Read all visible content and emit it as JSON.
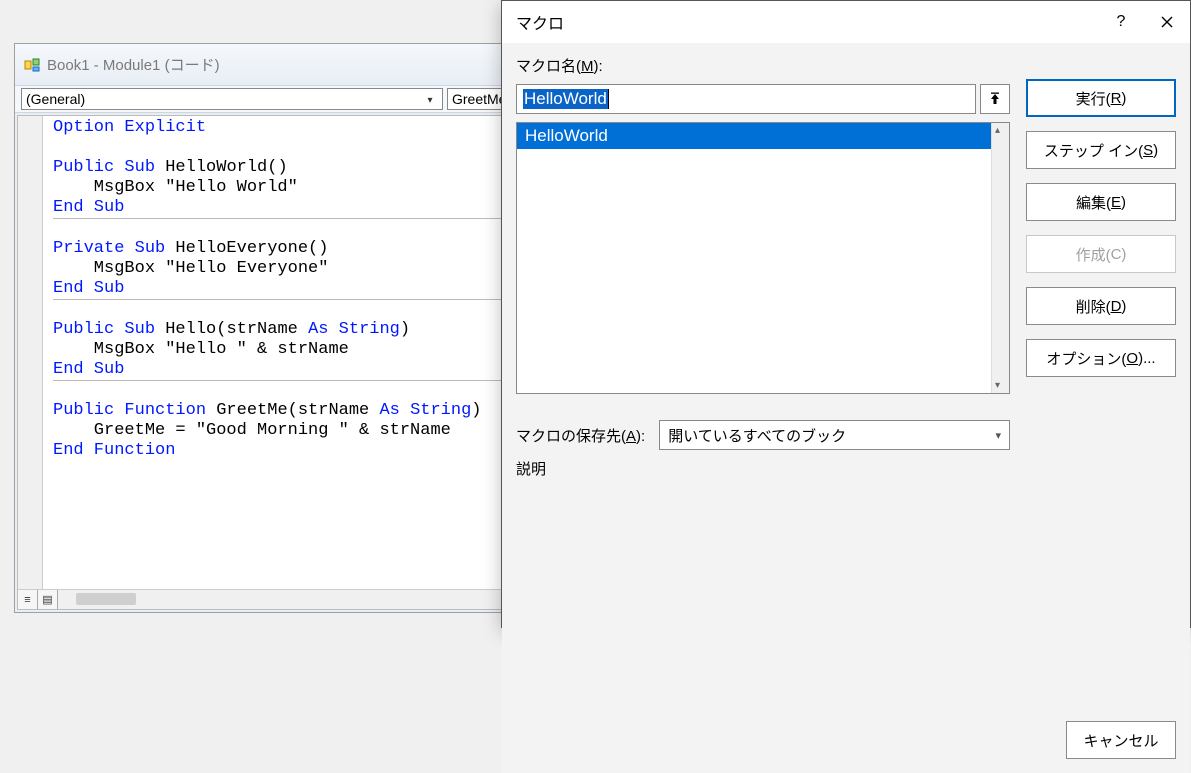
{
  "code_window": {
    "title": "Book1 - Module1 (コード)",
    "left_combo": "(General)",
    "right_combo": "GreetMe",
    "code_html": "<span class=\"kw\">Option Explicit</span>\n\n<span class=\"kw\">Public Sub</span> HelloWorld()\n    MsgBox \"Hello World\"\n<span class=\"kw\">End Sub</span>\n<hr class=\"hr-sep\">\n<span class=\"kw\">Private Sub</span> HelloEveryone()\n    MsgBox \"Hello Everyone\"\n<span class=\"kw\">End Sub</span>\n<hr class=\"hr-sep\">\n<span class=\"kw\">Public Sub</span> Hello(strName <span class=\"kw\">As String</span>)\n    MsgBox \"Hello \" & strName\n<span class=\"kw\">End Sub</span>\n<hr class=\"hr-sep\">\n<span class=\"kw\">Public Function</span> GreetMe(strName <span class=\"kw\">As String</span>)\n    GreetMe = \"Good Morning \" & strName\n<span class=\"kw\">End Function</span>\n"
  },
  "dialog": {
    "title": "マクロ",
    "macro_name_label_pre": "マクロ名(",
    "macro_name_key": "M",
    "macro_name_label_post": "):",
    "macro_name_value": "HelloWorld",
    "list": [
      "HelloWorld"
    ],
    "selected_index": 0,
    "save_label_pre": "マクロの保存先(",
    "save_key": "A",
    "save_label_post": "):",
    "save_value": "開いているすべてのブック",
    "desc_label": "説明",
    "buttons": {
      "run_pre": "実行(",
      "run_key": "R",
      "run_post": ")",
      "step_pre": "ステップ イン(",
      "step_key": "S",
      "step_post": ")",
      "edit_pre": "編集(",
      "edit_key": "E",
      "edit_post": ")",
      "create_pre": "作成(",
      "create_key": "C",
      "create_post": ")",
      "delete_pre": "削除(",
      "delete_key": "D",
      "delete_post": ")",
      "options_pre": "オプション(",
      "options_key": "O",
      "options_post": ")...",
      "cancel": "キャンセル"
    }
  }
}
